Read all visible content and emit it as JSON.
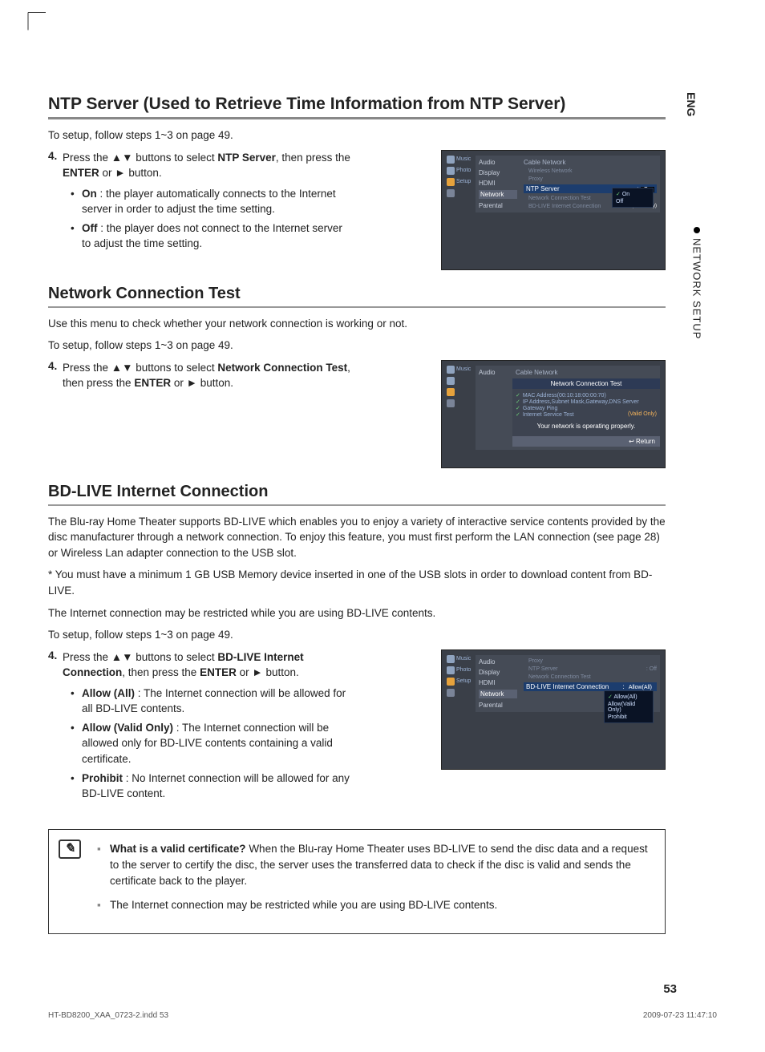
{
  "side": {
    "lang": "ENG",
    "section": "NETWORK SETUP"
  },
  "sec1": {
    "title": "NTP Server (Used to Retrieve Time Information from NTP Server)",
    "intro": "To setup, follow steps 1~3 on page 49.",
    "step_num": "4.",
    "step_a": "Press the ",
    "arrows": "▲▼",
    "step_b": " buttons to select ",
    "bold1": "NTP Server",
    "step_c": ", then press the ",
    "bold2": "ENTER",
    "step_d": " or ",
    "play": "►",
    "step_e": " button.",
    "on_label": "On",
    "on_text": " : the player automatically connects to the Internet server in order to adjust the time setting.",
    "off_label": "Off",
    "off_text": " : the player does not connect to the Internet server to adjust the time setting."
  },
  "mock1": {
    "icons": {
      "music": "Music",
      "photo": "Photo",
      "setup": "Setup"
    },
    "submenu": [
      "Audio",
      "Display",
      "HDMI",
      "Network",
      "Parental"
    ],
    "sel_index": 3,
    "items": {
      "cable": "Cable Network",
      "wireless": "Wireless Network",
      "proxy": "Proxy",
      "ntp": "NTP Server",
      "ntp_val": "On",
      "nct": "Network Connection Test",
      "bdlive": "BD-LIVE Internet Connection",
      "bdlive_val": "Allow (Valid Only)"
    },
    "popup": {
      "on": "On",
      "off": "Off"
    }
  },
  "sec2": {
    "title": "Network Connection Test",
    "p1": "Use this menu to check whether your network connection is working or not.",
    "p2": "To setup, follow steps 1~3 on page 49.",
    "step_num": "4.",
    "step_a": "Press the ",
    "arrows": "▲▼",
    "step_b": " buttons to select ",
    "bold1": "Network Connection Test",
    "step_c": ", then press the ",
    "bold2": "ENTER",
    "step_d": " or ",
    "play": "►",
    "step_e": " button."
  },
  "mock2": {
    "submenu": [
      "Audio"
    ],
    "title": "Network Connection Test",
    "cable": "Cable Network",
    "line1": "MAC Address(00:10:18:00:00:70)",
    "line2": "IP Address,Subnet Mask,Gateway,DNS Server",
    "line3": "Gateway Ping",
    "line4": "Internet Service Test",
    "valid": "(Valid Only)",
    "status": "Your network is operating properly.",
    "return": "↩ Return"
  },
  "sec3": {
    "title": "BD-LIVE Internet Connection",
    "p1": "The Blu-ray Home Theater supports BD-LIVE which enables you to enjoy a variety of interactive service contents provided by the disc manufacturer through a network connection. To enjoy this feature, you must first perform the LAN connection (see page 28) or Wireless Lan adapter connection to the USB slot.",
    "p2": "* You must have a minimum 1 GB USB Memory device inserted in one of the USB slots in order to download content from BD-LIVE.",
    "p3": "The Internet connection may be restricted while you are using BD-LIVE contents.",
    "p4": "To setup, follow steps 1~3 on page 49.",
    "step_num": "4.",
    "step_a": "Press the ",
    "arrows": "▲▼",
    "step_b": " buttons to select ",
    "bold1": "BD-LIVE Internet Connection",
    "step_c": ", then press the ",
    "bold2": "ENTER",
    "step_d": " or ",
    "play": "►",
    "step_e": " button.",
    "b1_label": "Allow (All)",
    "b1_text": " : The Internet connection will be allowed for all BD-LIVE contents.",
    "b2_label": "Allow (Valid Only)",
    "b2_text": " : The Internet connection will be allowed only for BD-LIVE contents containing a valid certificate.",
    "b3_label": "Prohibit",
    "b3_text": " : No Internet connection will be allowed for any BD-LIVE content."
  },
  "mock3": {
    "icons": {
      "music": "Music",
      "photo": "Photo",
      "setup": "Setup"
    },
    "submenu": [
      "Audio",
      "Display",
      "HDMI",
      "Network",
      "Parental"
    ],
    "sel_index": 3,
    "items": {
      "proxy": "Proxy",
      "ntp": "NTP Server",
      "ntp_val": "Off",
      "nct": "Network Connection Test",
      "bdlive": "BD-LIVE Internet Connection",
      "bdlive_val": "Allow(All)"
    },
    "popup": {
      "a": "Allow(All)",
      "b": "Allow(Valid Only)",
      "c": "Prohibit"
    }
  },
  "note": {
    "q": "What is a valid certificate?",
    "a": " When the Blu-ray Home Theater uses BD-LIVE to send the disc data and a request to the server to certify the disc, the server uses the transferred data to check if the disc is valid and sends the certificate back to the player.",
    "n2": "The Internet connection may be restricted while you are using BD-LIVE contents."
  },
  "footer": {
    "page": "53",
    "file": "HT-BD8200_XAA_0723-2.indd   53",
    "datetime": "2009-07-23   11:47:10"
  }
}
